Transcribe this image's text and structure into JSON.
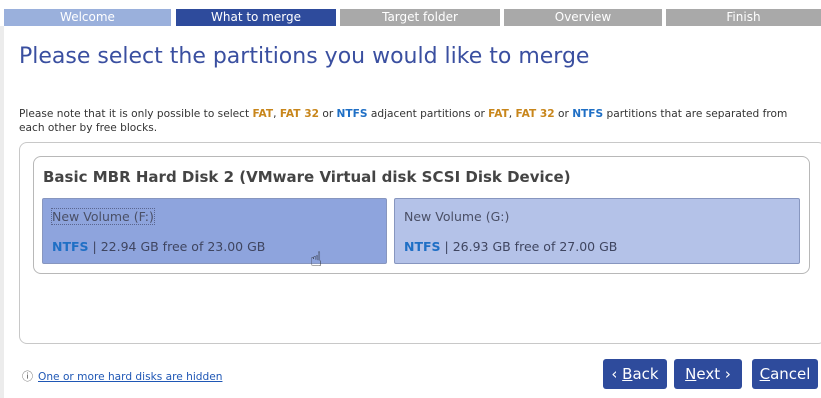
{
  "wizard_steps": [
    {
      "label": "Welcome",
      "state": "done"
    },
    {
      "label": "What to merge",
      "state": "active"
    },
    {
      "label": "Target folder",
      "state": "pending"
    },
    {
      "label": "Overview",
      "state": "pending"
    },
    {
      "label": "Finish",
      "state": "pending"
    }
  ],
  "page_title": "Please select the partitions you would like to merge",
  "note": {
    "part1": "Please note that it is only possible to select ",
    "fat": "FAT",
    "sep1": ", ",
    "fat32": "FAT 32",
    "or1": " or ",
    "ntfs": "NTFS",
    "part2": " adjacent partitions or ",
    "fat_b": "FAT",
    "sep2": ", ",
    "fat32_b": "FAT 32",
    "or2": " or ",
    "ntfs_b": "NTFS",
    "part3": " partitions that are separated from each other by free blocks."
  },
  "disk": {
    "title": "Basic MBR Hard Disk 2 (VMware Virtual disk SCSI Disk Device)",
    "partitions": [
      {
        "label": "New Volume (F:)",
        "fs": "NTFS",
        "info": " | 22.94 GB free of 23.00 GB",
        "selected": true
      },
      {
        "label": "New Volume (G:)",
        "fs": "NTFS",
        "info": " | 26.93 GB free of 27.00 GB",
        "selected": false
      }
    ]
  },
  "footer": {
    "info_icon": "ⓘ",
    "hidden_disks_link": "One or more hard disks are hidden",
    "back_prefix": "‹ ",
    "back_access": "B",
    "back_rest": "ack",
    "next_access": "N",
    "next_rest": "ext ›",
    "cancel_access": "C",
    "cancel_rest": "ancel"
  },
  "colors": {
    "accent": "#2e4b9c",
    "step_done": "#9ab0dc",
    "step_pending": "#a9a9a9",
    "fat_keyword": "#c8861b",
    "ntfs_keyword": "#1f6fc5",
    "partition_selected": "#8ea4dd",
    "partition_normal": "#b4c2e8"
  }
}
